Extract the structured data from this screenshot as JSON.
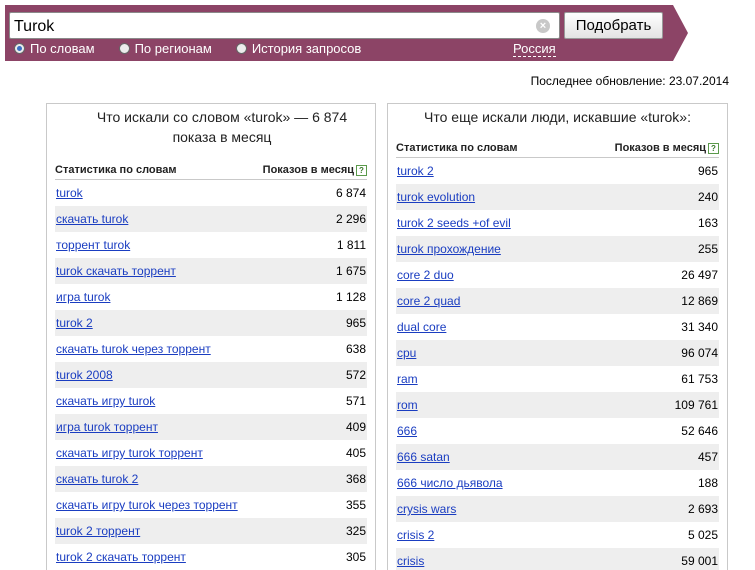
{
  "search": {
    "query": "Turok",
    "clear_icon": "×",
    "button_label": "Подобрать"
  },
  "modes": [
    {
      "label": "По словам",
      "checked": true
    },
    {
      "label": "По регионам",
      "checked": false
    },
    {
      "label": "История запросов",
      "checked": false
    }
  ],
  "region": "Россия",
  "updated": "Последнее обновление: 23.07.2014",
  "colors": {
    "bar": "#8c4466",
    "link": "#1a3dc1",
    "row_stripe": "#eeeeee"
  },
  "left": {
    "title": "Что искали со словом «turok» — 6 874 показа в месяц",
    "col_query": "Статистика по словам",
    "col_count": "Показов в месяц",
    "rows": [
      {
        "q": "turok",
        "n": "6 874"
      },
      {
        "q": "скачать turok",
        "n": "2 296"
      },
      {
        "q": "торрент turok",
        "n": "1 811"
      },
      {
        "q": "turok скачать торрент",
        "n": "1 675"
      },
      {
        "q": "игра turok",
        "n": "1 128"
      },
      {
        "q": "turok 2",
        "n": "965"
      },
      {
        "q": "скачать turok через торрент",
        "n": "638"
      },
      {
        "q": "turok 2008",
        "n": "572"
      },
      {
        "q": "скачать игру turok",
        "n": "571"
      },
      {
        "q": "игра turok торрент",
        "n": "409"
      },
      {
        "q": "скачать игру turok торрент",
        "n": "405"
      },
      {
        "q": "скачать turok 2",
        "n": "368"
      },
      {
        "q": "скачать игру turok через торрент",
        "n": "355"
      },
      {
        "q": "turok 2 торрент",
        "n": "325"
      },
      {
        "q": "turok 2 скачать торрент",
        "n": "305"
      }
    ]
  },
  "right": {
    "title": "Что еще искали люди, искавшие «turok»:",
    "col_query": "Статистика по словам",
    "col_count": "Показов в месяц",
    "rows": [
      {
        "q": "turok 2",
        "n": "965"
      },
      {
        "q": "turok evolution",
        "n": "240"
      },
      {
        "q": "turok 2 seeds +of evil",
        "n": "163"
      },
      {
        "q": "turok прохождение",
        "n": "255"
      },
      {
        "q": "core 2 duo",
        "n": "26 497"
      },
      {
        "q": "core 2 quad",
        "n": "12 869"
      },
      {
        "q": "dual core",
        "n": "31 340"
      },
      {
        "q": "cpu",
        "n": "96 074"
      },
      {
        "q": "ram",
        "n": "61 753"
      },
      {
        "q": "rom",
        "n": "109 761"
      },
      {
        "q": "666",
        "n": "52 646"
      },
      {
        "q": "666 satan",
        "n": "457"
      },
      {
        "q": "666 число дьявола",
        "n": "188"
      },
      {
        "q": "crysis wars",
        "n": "2 693"
      },
      {
        "q": "crisis 2",
        "n": "5 025"
      },
      {
        "q": "crisis",
        "n": "59 001"
      }
    ]
  }
}
